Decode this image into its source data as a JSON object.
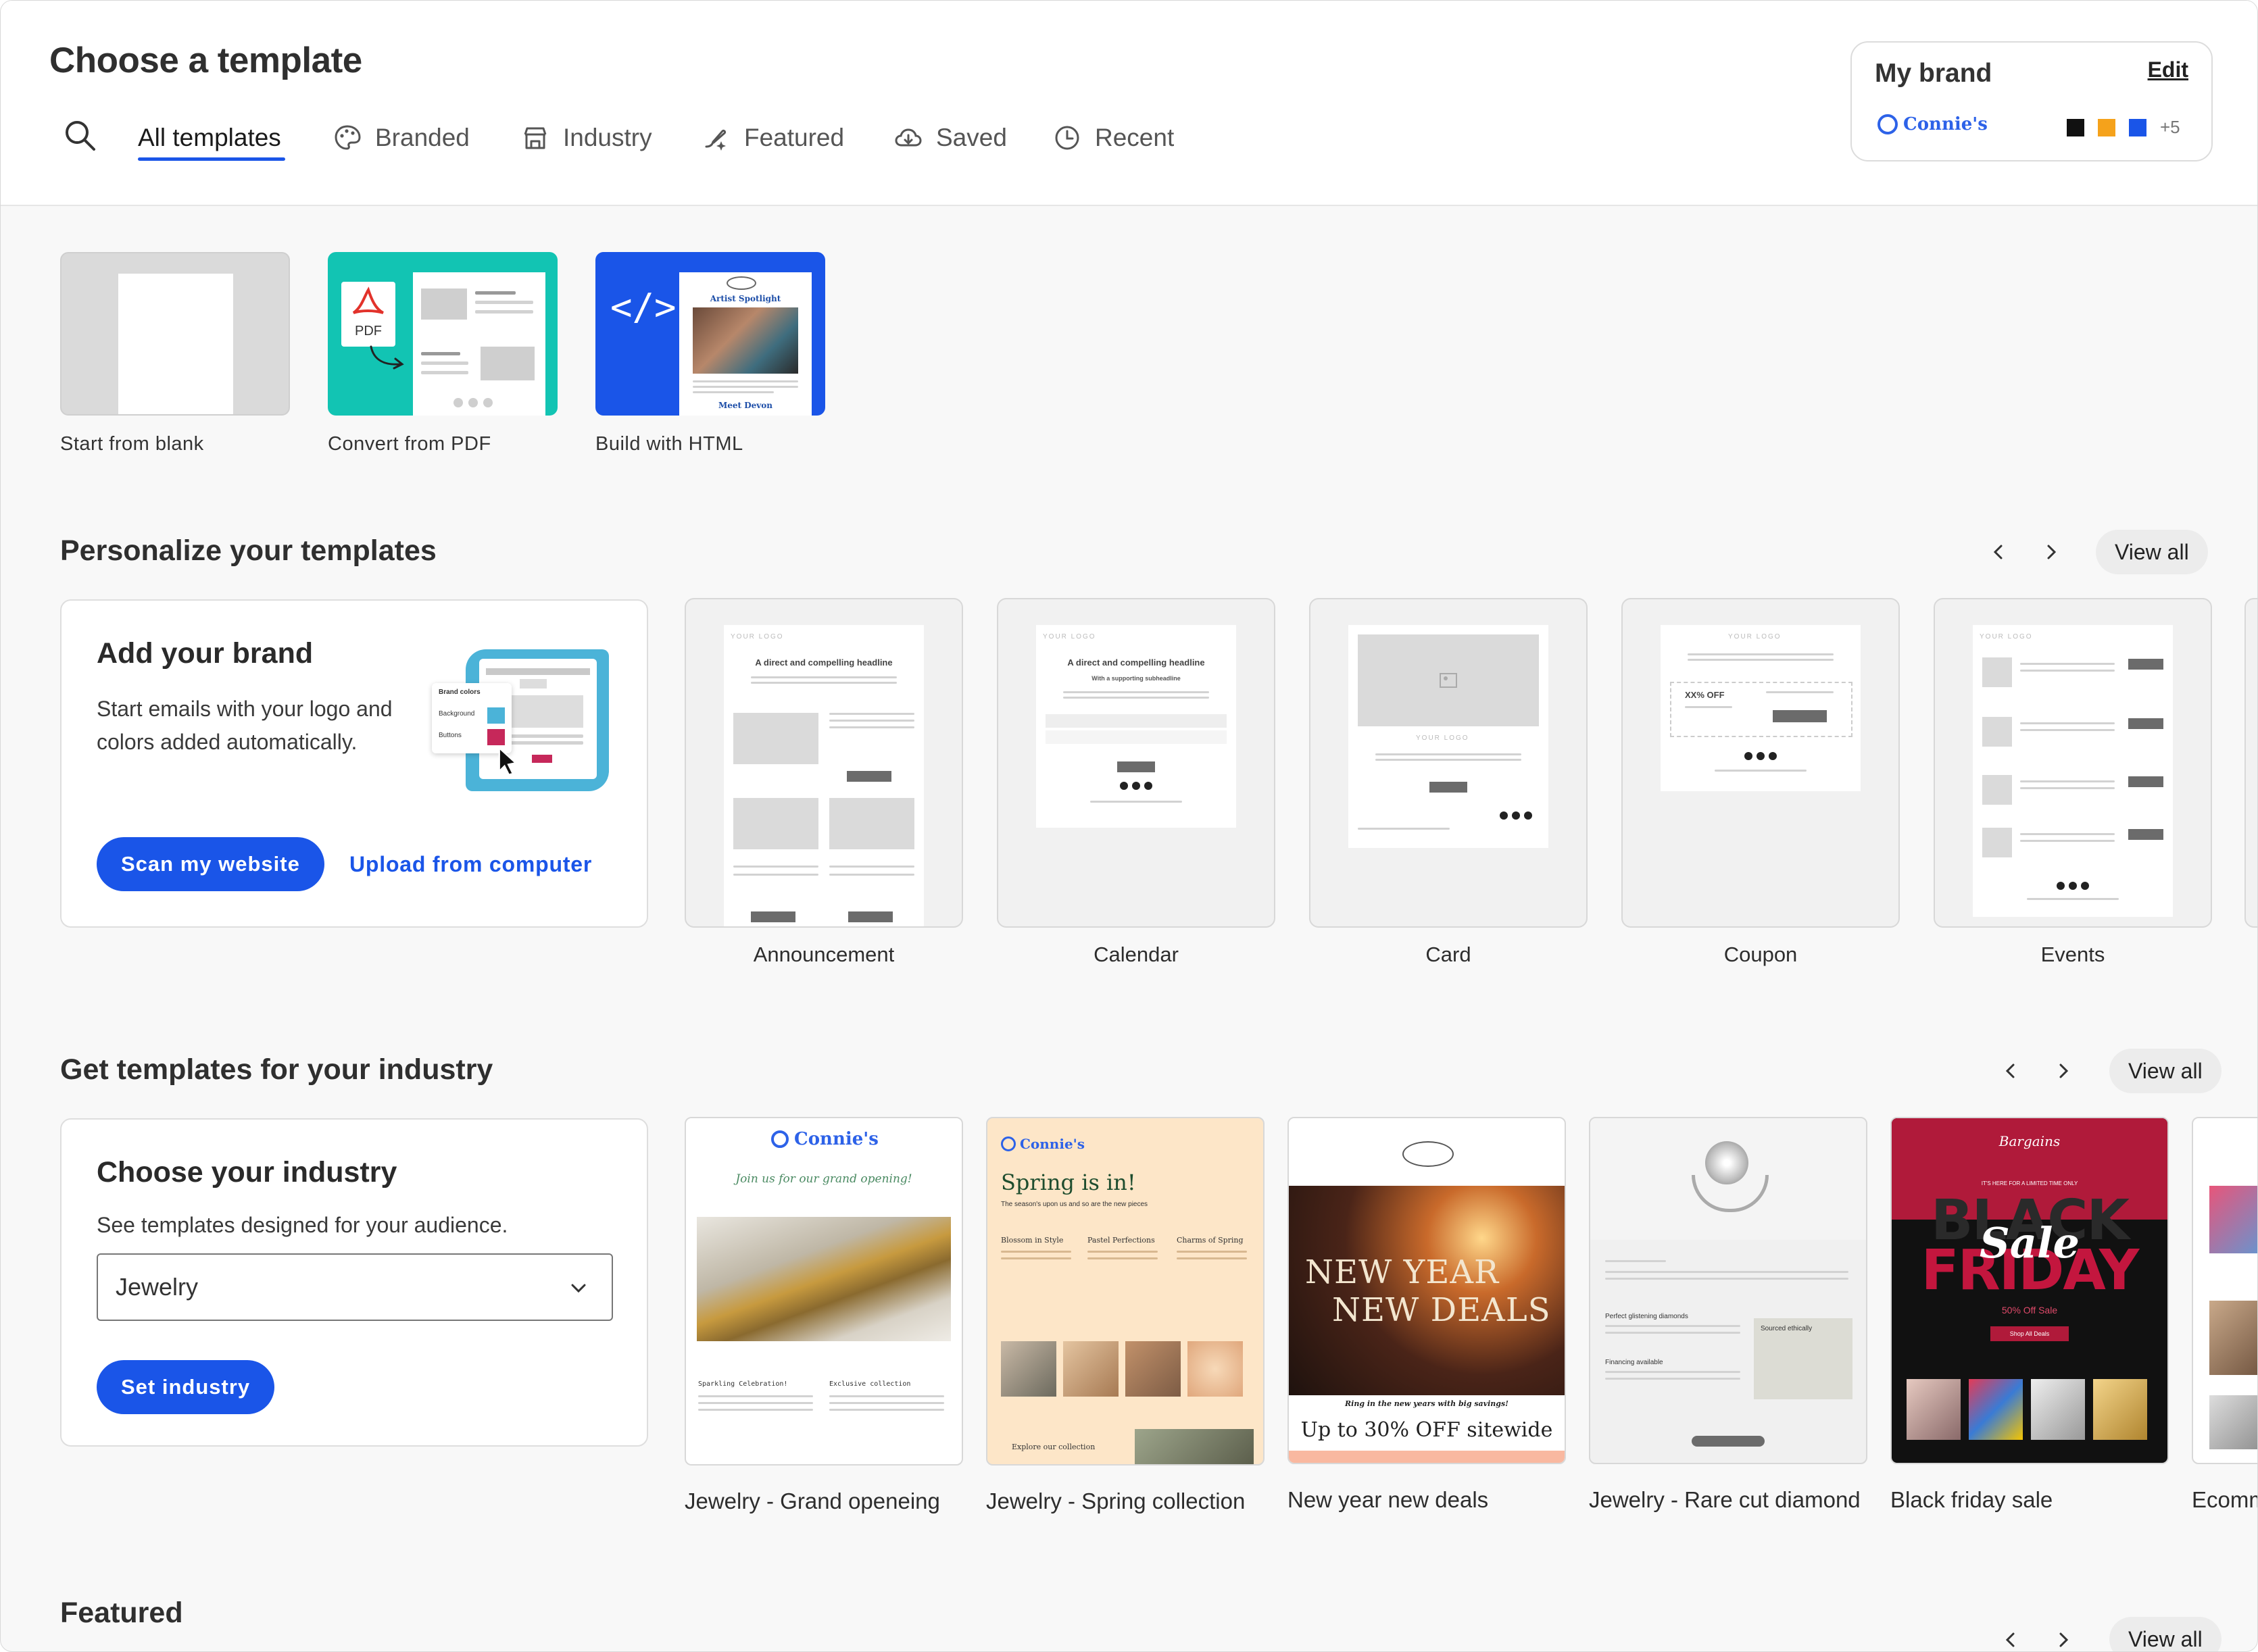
{
  "header": {
    "title": "Choose a template",
    "tabs": [
      {
        "label": "All templates",
        "icon": "search-icon",
        "active": true
      },
      {
        "label": "Branded",
        "icon": "palette-icon"
      },
      {
        "label": "Industry",
        "icon": "store-icon"
      },
      {
        "label": "Featured",
        "icon": "sparkle-brush-icon"
      },
      {
        "label": "Saved",
        "icon": "cloud-download-icon"
      },
      {
        "label": "Recent",
        "icon": "clock-icon"
      }
    ]
  },
  "brand": {
    "title": "My brand",
    "edit_label": "Edit",
    "logo_text": "Connie's",
    "colors": [
      "#111111",
      "#f5a21b",
      "#1a55e8"
    ],
    "more_colors": "+5"
  },
  "starters": [
    {
      "label": "Start from blank"
    },
    {
      "label": "Convert from PDF",
      "badge": "PDF"
    },
    {
      "label": "Build with HTML",
      "code_glyph": "</>",
      "preview_title": "Artist Spotlight",
      "preview_footer": "Meet Devon"
    }
  ],
  "personalize": {
    "title": "Personalize your templates",
    "view_all": "View all",
    "promo": {
      "title": "Add your brand",
      "text_line1": "Start emails with your logo and",
      "text_line2": "colors added automatically.",
      "primary": "Scan my website",
      "secondary": "Upload from computer",
      "illus_brand_colors": "Brand colors",
      "illus_background": "Background",
      "illus_buttons": "Buttons"
    },
    "templates": [
      {
        "label": "Announcement",
        "headline": "A direct and compelling headline",
        "logo": "YOUR LOGO"
      },
      {
        "label": "Calendar",
        "headline": "A direct and compelling headline",
        "sub": "With a supporting subheadline",
        "logo": "YOUR LOGO"
      },
      {
        "label": "Card",
        "logo": "YOUR LOGO"
      },
      {
        "label": "Coupon",
        "offer": "XX% OFF",
        "logo": "YOUR LOGO"
      },
      {
        "label": "Events",
        "logo": "YOUR LOGO"
      }
    ]
  },
  "industry": {
    "title": "Get templates for your industry",
    "view_all": "View all",
    "promo": {
      "title": "Choose your industry",
      "text": "See templates designed for your audience.",
      "selected": "Jewelry",
      "button": "Set industry"
    },
    "templates": [
      {
        "label": "Jewelry - Grand openeing",
        "brand": "Connie's",
        "script": "Join us for our grand opening!",
        "col1": "Sparkling Celebration!",
        "col2": "Exclusive collection"
      },
      {
        "label": "Jewelry - Spring collection",
        "brand": "Connie's",
        "headline": "Spring is in!",
        "sub": "The season's upon us and so are the new pieces",
        "cols": [
          "Blossom in Style",
          "Pastel Perfections",
          "Charms of Spring"
        ],
        "footer": "Explore our collection"
      },
      {
        "label": "New year new deals",
        "line1": "NEW YEAR",
        "line2": "NEW DEALS",
        "tag": "Ring in the new years with big savings!",
        "offer": "Up to 30% OFF sitewide"
      },
      {
        "label": "Jewelry - Rare cut diamond",
        "h1": "Perfect glistening diamonds",
        "h2": "Sourced ethically",
        "h3": "Financing available"
      },
      {
        "label": "Black friday sale",
        "brand": "Bargains",
        "banner": "IT'S HERE FOR A LIMITED TIME ONLY",
        "big1": "BLACK",
        "big2": "FRIDAY",
        "script": "Sale",
        "off": "50% Off Sale",
        "cta": "Shop All Deals"
      },
      {
        "label": "Ecomm"
      }
    ]
  },
  "featured": {
    "title": "Featured",
    "view_all": "View all"
  },
  "colors": {
    "accent": "#1a55e8",
    "teal": "#12c4b3"
  }
}
